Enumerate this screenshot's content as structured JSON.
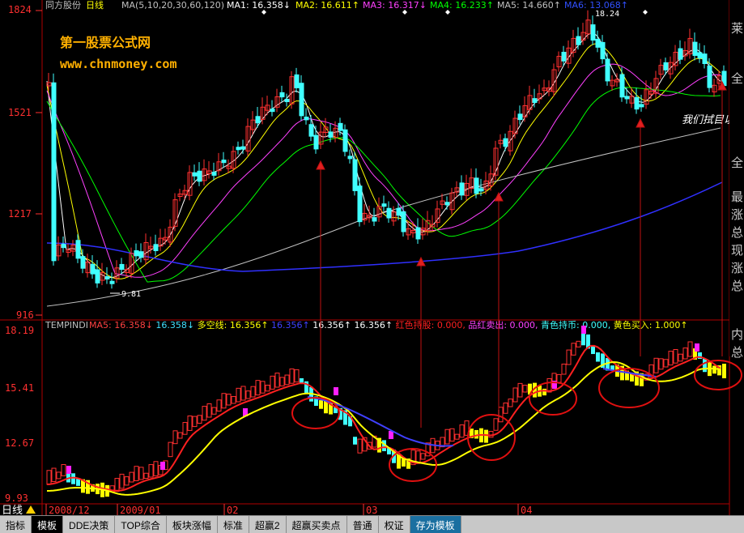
{
  "header": {
    "stock_name": "同方股份",
    "period": "日线",
    "ma_label": "MA(5,10,20,30,60,120)",
    "ma1": "MA1: 16.358↓",
    "ma2": "MA2: 16.611↑",
    "ma3": "MA3: 16.317↓",
    "ma4": "MA4: 16.233↑",
    "ma5": "MA5: 14.660↑",
    "ma6": "MA6: 13.068↑"
  },
  "watermark": {
    "line1": "第一股票公式网",
    "line2": "www.chnmoney.com"
  },
  "main_axis": {
    "labels": [
      "1824",
      "1521",
      "1217",
      "916"
    ],
    "high_label": "18.24",
    "low_label": "9.81"
  },
  "annotation": "我们拭目以",
  "indicator": {
    "name": "TEMPINDI",
    "items": [
      {
        "text": "MA5: 16.358↓",
        "color": "#ff4040"
      },
      {
        "text": "16.358↓",
        "color": "#40e0ff"
      },
      {
        "text": "多空线: 16.356↑",
        "color": "#ffff00"
      },
      {
        "text": "16.356↑",
        "color": "#4040ff"
      },
      {
        "text": "16.356↑",
        "color": "#ffffff"
      },
      {
        "text": "16.356↑",
        "color": "#ffffff"
      },
      {
        "text": "红色持股: 0.000,",
        "color": "#ff2020"
      },
      {
        "text": "品红卖出: 0.000,",
        "color": "#ff40ff"
      },
      {
        "text": "青色持币: 0.000,",
        "color": "#40ffff"
      },
      {
        "text": "黄色买入: 1.000↑",
        "color": "#ffff00"
      }
    ],
    "axis_labels": [
      "18.19",
      "15.41",
      "12.67",
      "9.93"
    ]
  },
  "time_axis": {
    "period_btn": "日线",
    "labels": [
      "2008/12",
      "2009/01",
      "02",
      "03",
      "04"
    ]
  },
  "side_text": [
    "最",
    "涨",
    "总",
    "现",
    "涨",
    "总",
    "内",
    "总"
  ],
  "side_top": [
    "莱",
    "全",
    "全"
  ],
  "tabs": [
    {
      "label": "指标",
      "state": "normal"
    },
    {
      "label": "模板",
      "state": "active"
    },
    {
      "label": "DDE决策",
      "state": "normal"
    },
    {
      "label": "TOP综合",
      "state": "normal"
    },
    {
      "label": "板块涨幅",
      "state": "normal"
    },
    {
      "label": "标准",
      "state": "normal"
    },
    {
      "label": "超赢2",
      "state": "normal"
    },
    {
      "label": "超赢买卖点",
      "state": "normal"
    },
    {
      "label": "普通",
      "state": "normal"
    },
    {
      "label": "权证",
      "state": "normal"
    },
    {
      "label": "存为模板",
      "state": "highlight"
    }
  ],
  "colors": {
    "up": "#ff3030",
    "down": "#40ffff",
    "ma1": "#ffffff",
    "ma2": "#ffff00",
    "ma3": "#ff40ff",
    "ma4": "#00ff00",
    "ma5": "#c0c0c0",
    "ma6": "#3030ff",
    "axis": "#b00000"
  }
}
